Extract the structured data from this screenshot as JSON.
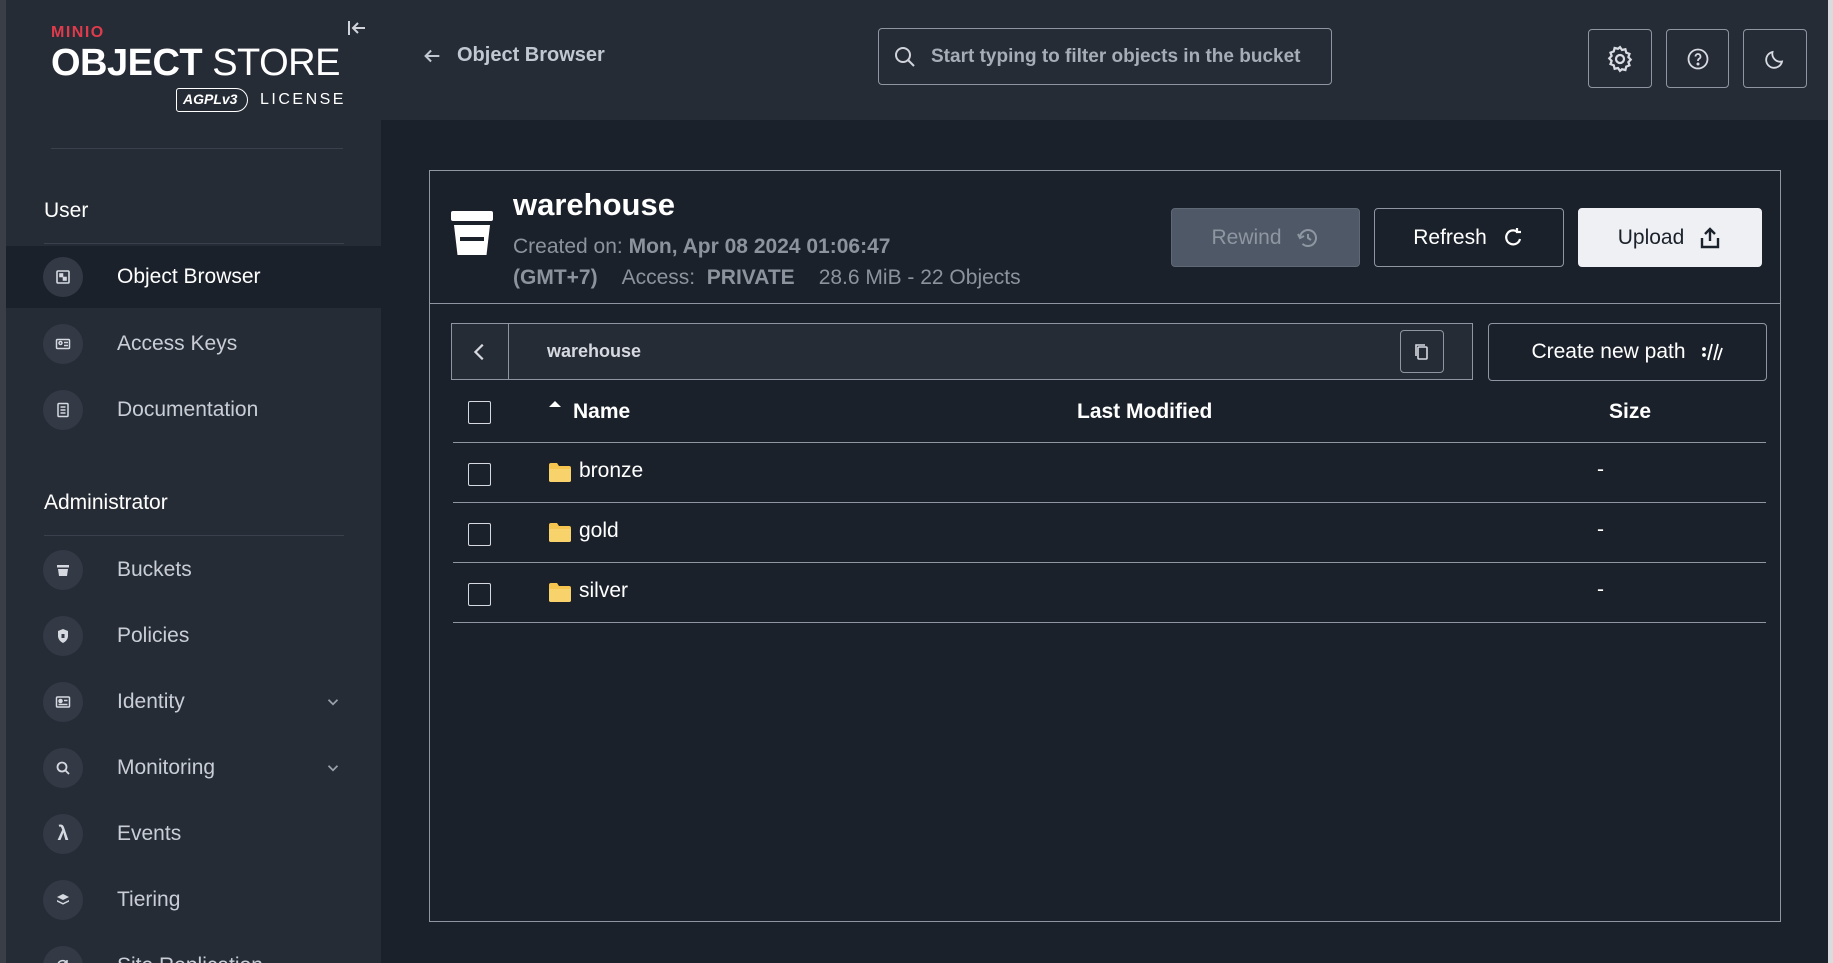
{
  "logo": {
    "brand": "MINIO",
    "product_bold": "OBJECT",
    "product_light": "STORE",
    "agpl": "AGPLv3",
    "license": "LICENSE"
  },
  "sidebar": {
    "user_section": "User",
    "admin_section": "Administrator",
    "user_items": [
      {
        "label": "Object Browser",
        "icon": "object-browser-icon",
        "active": true
      },
      {
        "label": "Access Keys",
        "icon": "access-keys-icon"
      },
      {
        "label": "Documentation",
        "icon": "documentation-icon"
      }
    ],
    "admin_items": [
      {
        "label": "Buckets",
        "icon": "bucket-icon"
      },
      {
        "label": "Policies",
        "icon": "policies-icon"
      },
      {
        "label": "Identity",
        "icon": "identity-icon",
        "expandable": true
      },
      {
        "label": "Monitoring",
        "icon": "monitoring-icon",
        "expandable": true
      },
      {
        "label": "Events",
        "icon": "lambda-icon"
      },
      {
        "label": "Tiering",
        "icon": "tiering-icon"
      },
      {
        "label": "Site Replication",
        "icon": "site-replication-icon"
      }
    ]
  },
  "header": {
    "back_label": "Object Browser",
    "search_placeholder": "Start typing to filter objects in the bucket"
  },
  "bucket": {
    "name": "warehouse",
    "created_label": "Created on:",
    "created_value": "Mon, Apr 08 2024 01:06:47",
    "timezone": "(GMT+7)",
    "access_label": "Access:",
    "access_value": "PRIVATE",
    "usage": "28.6 MiB - 22 Objects",
    "rewind_label": "Rewind",
    "refresh_label": "Refresh",
    "upload_label": "Upload"
  },
  "path": {
    "current": "warehouse",
    "create_label": "Create new path"
  },
  "table": {
    "columns": {
      "name": "Name",
      "modified": "Last Modified",
      "size": "Size"
    },
    "rows": [
      {
        "name": "bronze",
        "modified": "",
        "size": "-"
      },
      {
        "name": "gold",
        "modified": "",
        "size": "-"
      },
      {
        "name": "silver",
        "modified": "",
        "size": "-"
      }
    ]
  },
  "colors": {
    "sidebar_bg": "#262c36",
    "main_bg": "#1b212b",
    "brand_red": "#e03b4c",
    "folder_yellow": "#f5c54f"
  }
}
